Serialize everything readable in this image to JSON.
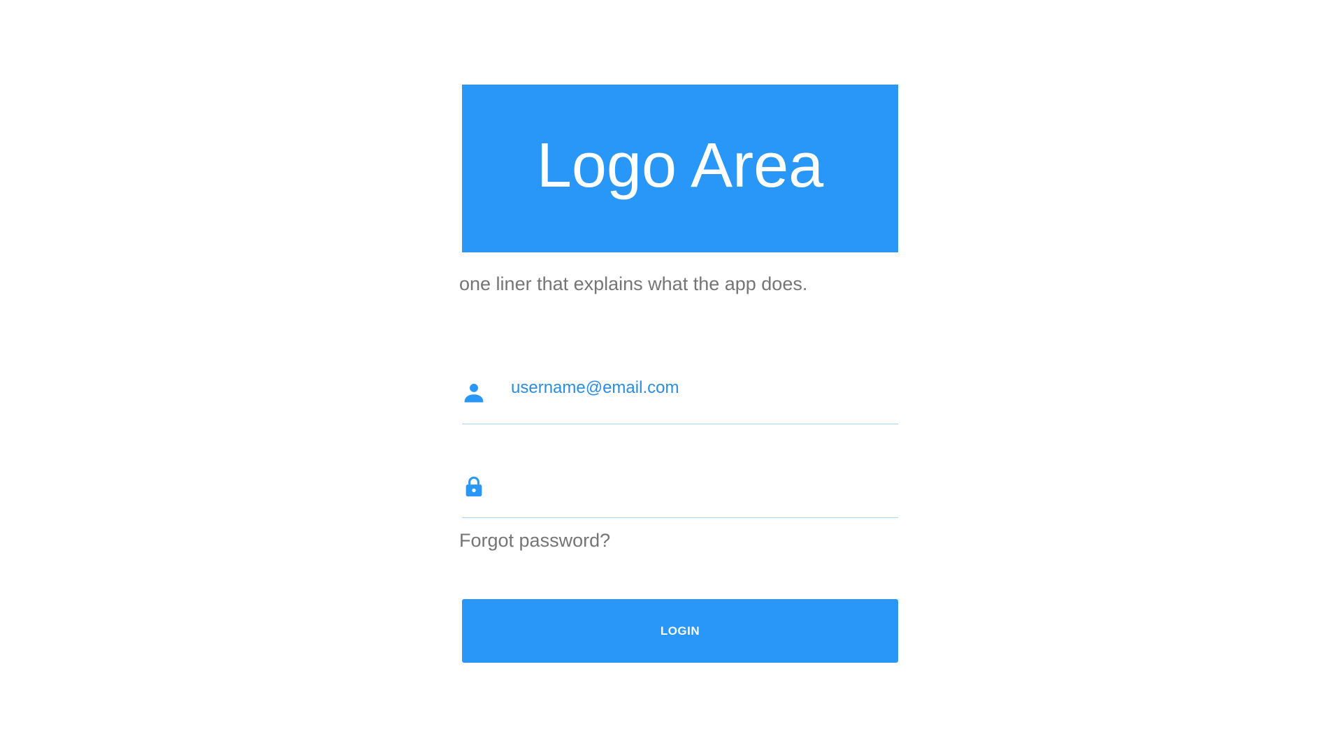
{
  "logo": {
    "text": "Logo Area",
    "background_color": "#2897f7"
  },
  "tagline": "one liner that explains what the app does.",
  "form": {
    "username": {
      "icon": "person-icon",
      "value": "username@email.com",
      "placeholder": ""
    },
    "password": {
      "icon": "lock-icon",
      "value": "",
      "placeholder": ""
    },
    "forgot_password_label": "Forgot password?",
    "login_button_label": "LOGIN"
  },
  "colors": {
    "accent": "#2897f7",
    "input_text": "#2b8de0",
    "muted_text": "#757575",
    "underline": "#a8d4ef"
  }
}
